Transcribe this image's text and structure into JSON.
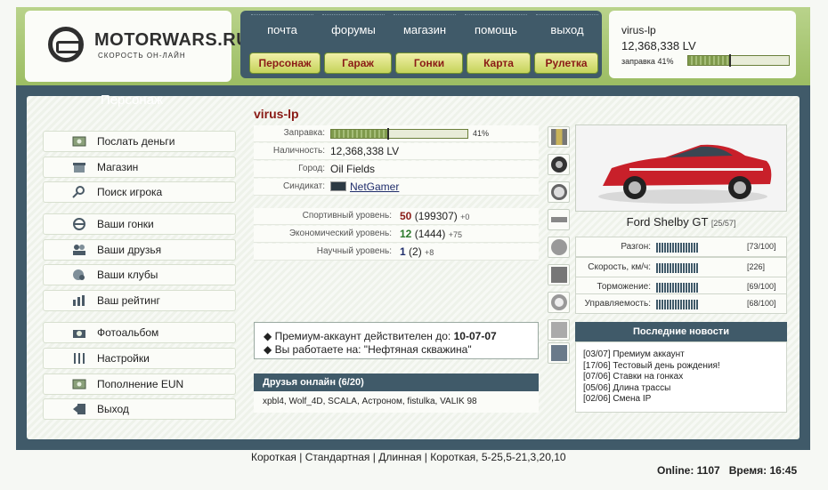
{
  "logo": {
    "title": "MOTORWARS.RU",
    "subtitle": "СКОРОСТЬ ОН-ЛАЙН"
  },
  "top_links": [
    "почта",
    "форумы",
    "магазин",
    "помощь",
    "выход"
  ],
  "top_buttons": [
    "Персонаж",
    "Гараж",
    "Гонки",
    "Карта",
    "Рулетка"
  ],
  "user": {
    "name": "virus-lp",
    "cash": "12,368,338 LV",
    "fuel_label": "заправка 41%",
    "fuel_fraction": 0.41
  },
  "sidebar": {
    "title": "Персонаж",
    "items": [
      {
        "label": "Послать деньги",
        "icon": "money-icon"
      },
      {
        "label": "Магазин",
        "icon": "shop-icon"
      },
      {
        "label": "Поиск игрока",
        "icon": "search-icon"
      },
      {
        "label": "Ваши гонки",
        "icon": "steering-wheel-icon"
      },
      {
        "label": "Ваши друзья",
        "icon": "friends-icon"
      },
      {
        "label": "Ваши клубы",
        "icon": "clubs-icon"
      },
      {
        "label": "Ваш рейтинг",
        "icon": "rating-icon"
      },
      {
        "label": "Фотоальбом",
        "icon": "camera-icon"
      },
      {
        "label": "Настройки",
        "icon": "settings-icon"
      },
      {
        "label": "Пополнение EUN",
        "icon": "money-icon"
      },
      {
        "label": "Выход",
        "icon": "exit-icon"
      }
    ]
  },
  "character": {
    "name": "virus-lp",
    "fuel_label": "Заправка:",
    "fuel_pct": "41%",
    "fuel_fraction": 0.41,
    "cash_label": "Наличность:",
    "cash": "12,368,338 LV",
    "city_label": "Город:",
    "city": "Oil Fields",
    "syndicate_label": "Синдикат:",
    "syndicate": "NetGamer",
    "sport_label": "Спортивный уровень:",
    "sport_level": "50",
    "sport_points": "(199307)",
    "sport_delta": "+0",
    "econ_label": "Экономический уровень:",
    "econ_level": "12",
    "econ_points": "(1444)",
    "econ_delta": "+75",
    "sci_label": "Научный уровень:",
    "sci_level": "1",
    "sci_points": "(2)",
    "sci_delta": "+8"
  },
  "premium": {
    "line1": "Премиум-аккаунт действителен до:",
    "date": "10-07-07",
    "line2": "Вы работаете на: \"Нефтяная скважина\""
  },
  "friends": {
    "title": "Друзья онлайн (6/20)",
    "list": "xpbl4, Wolf_4D, SCALA, Астроном, fistulka, VALIK 98"
  },
  "car": {
    "name": "Ford Shelby GT",
    "slots": "[25/57]"
  },
  "car_stats": [
    {
      "label": "Разгон:",
      "value": "[73/100]"
    },
    {
      "label": "Скорость, км/ч:",
      "value": "[226]"
    },
    {
      "label": "Торможение:",
      "value": "[69/100]"
    },
    {
      "label": "Управляемость:",
      "value": "[68/100]"
    }
  ],
  "news": {
    "title": "Последние новости",
    "items": [
      "[03/07] Премиум аккаунт",
      "[17/06] Тестовый день рождения!",
      "[07/06] Ставки на гонках",
      "[05/06] Длина трассы",
      "[02/06] Смена IP"
    ]
  },
  "footer": {
    "links": "Короткая | Стандартная | Длинная | Короткая, 5-25,5-21,3,20,10",
    "online": "Online: 1107",
    "time": "Время: 16:45"
  },
  "colors": {
    "accent": "#405a69",
    "brand_red": "#8a1b16",
    "green": "#9cbd63"
  }
}
